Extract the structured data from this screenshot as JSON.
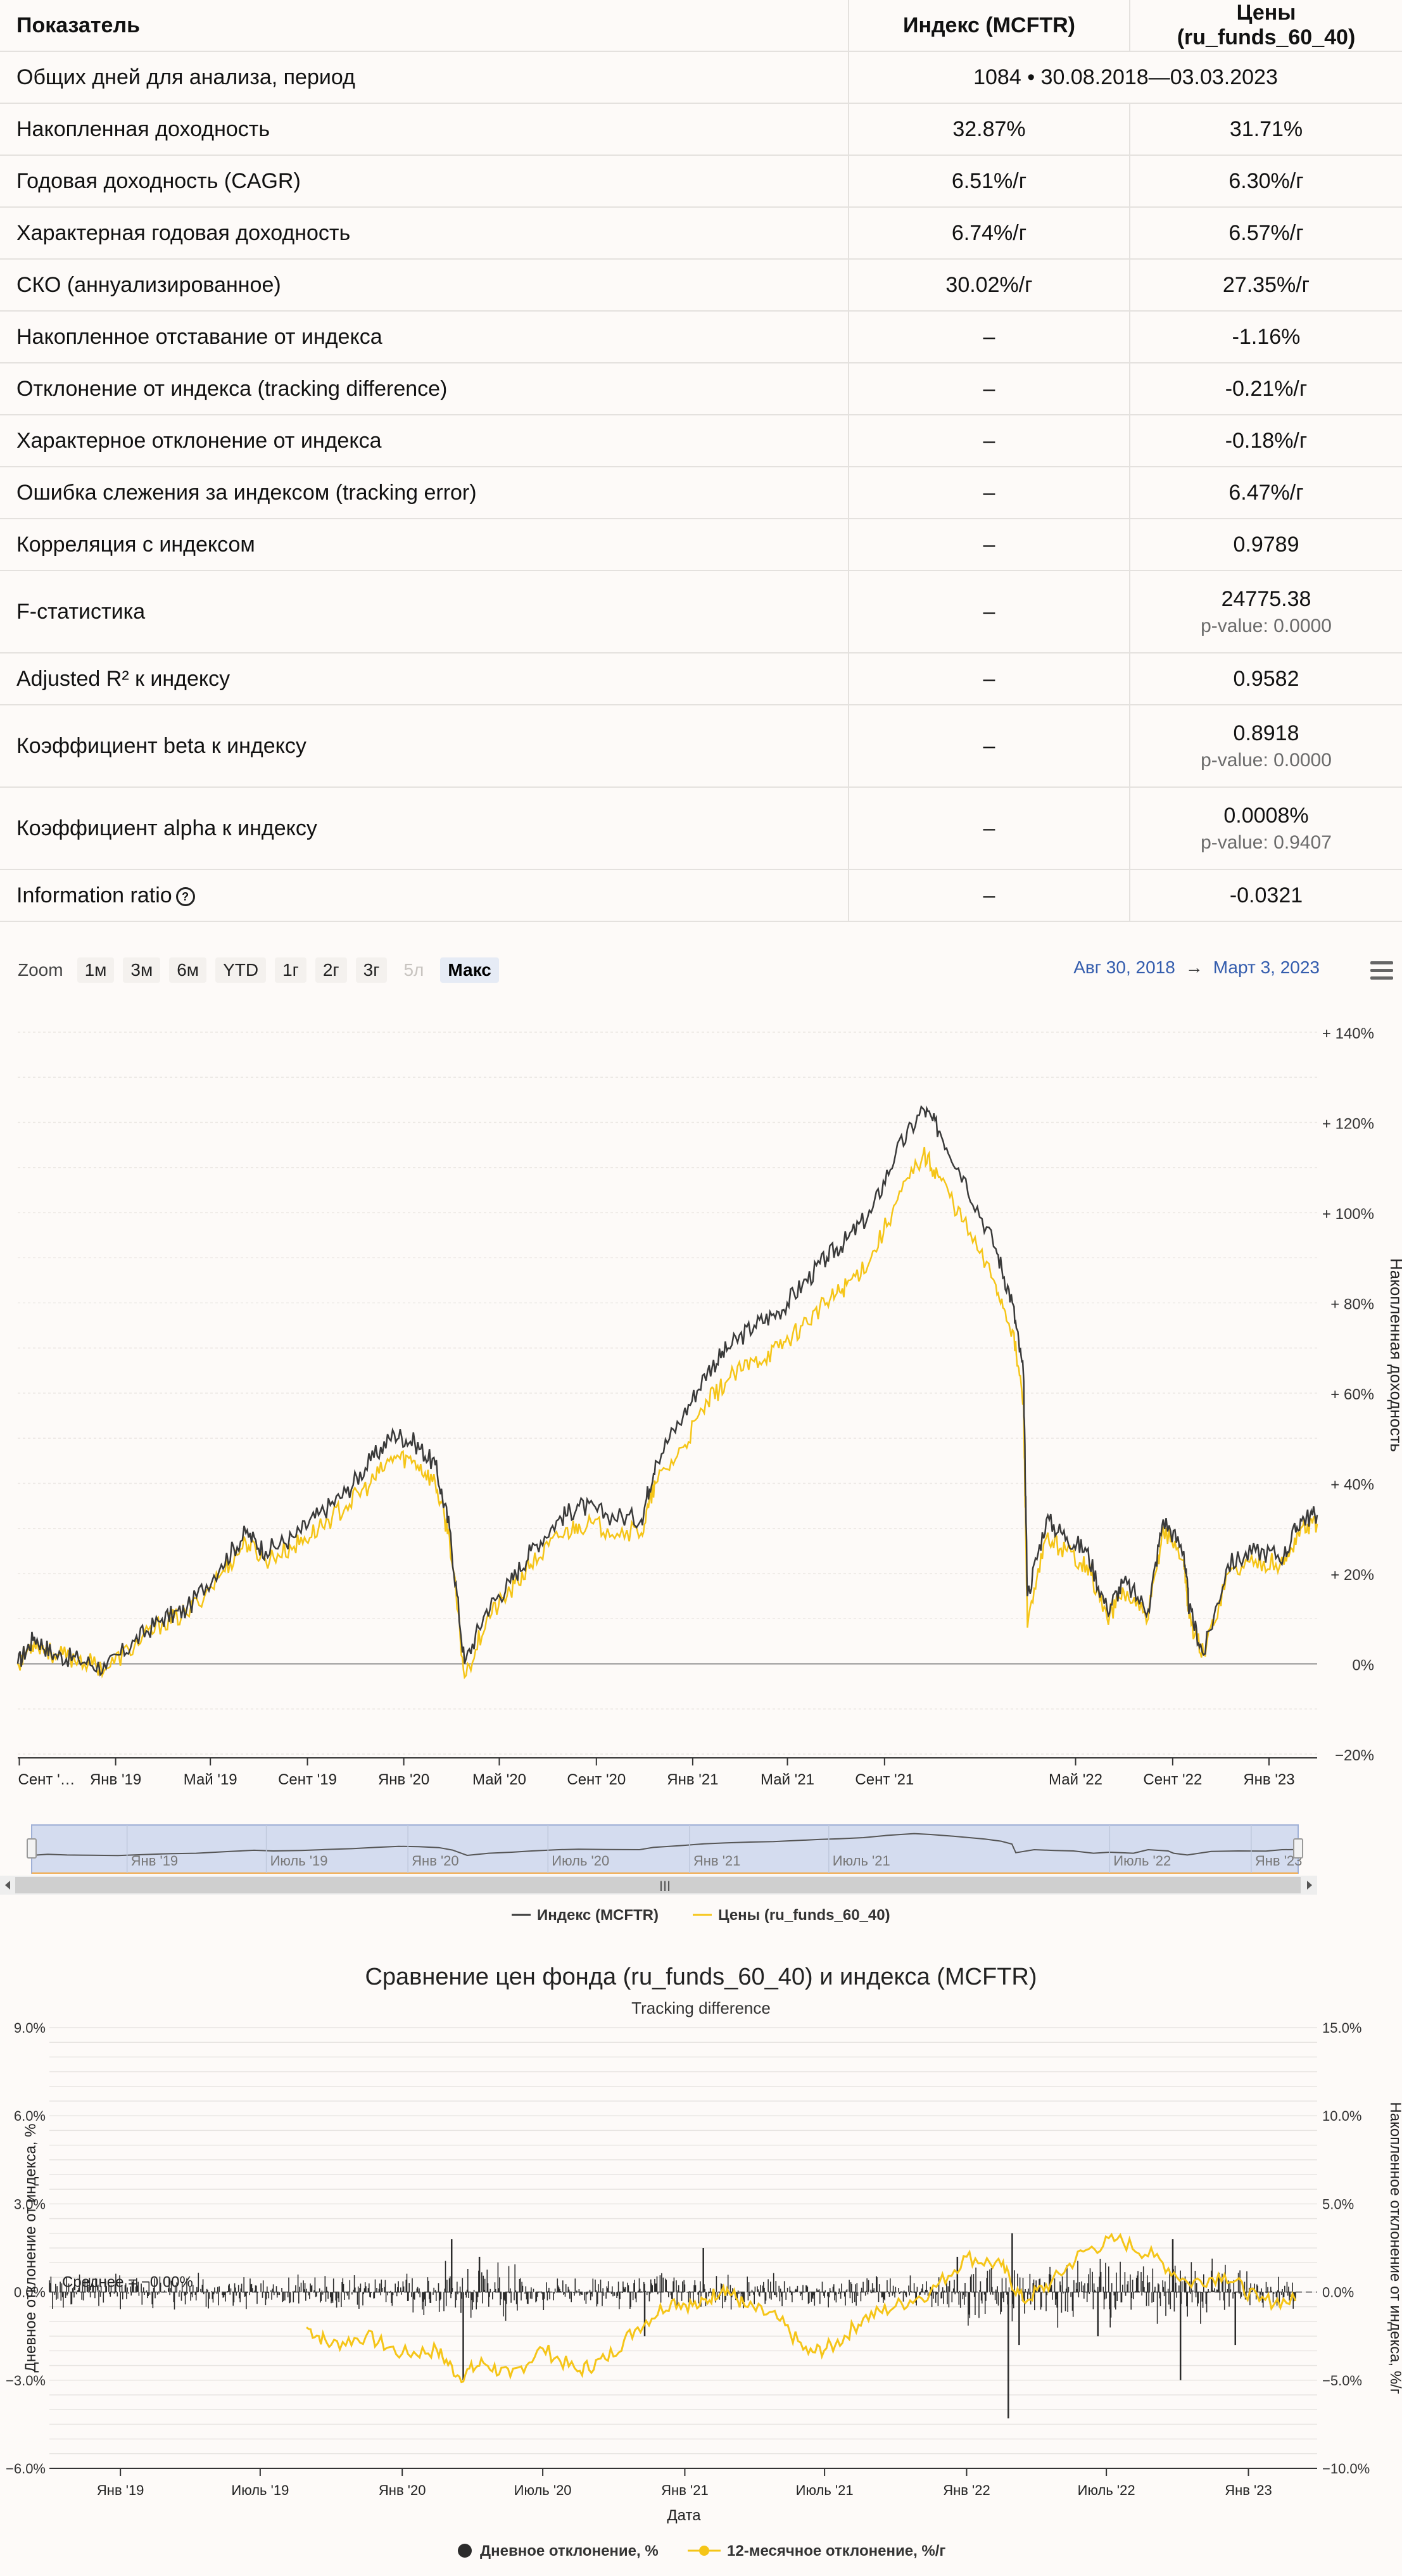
{
  "table": {
    "headers": [
      "Показатель",
      "Индекс (MCFTR)",
      "Цены (ru_funds_60_40)"
    ],
    "period_row": {
      "label": "Общих дней для анализа, период",
      "value": "1084 • 30.08.2018—03.03.2023"
    },
    "rows": [
      {
        "label": "Накопленная доходность",
        "index": "32.87%",
        "fund": "31.71%",
        "fund_sub": ""
      },
      {
        "label": "Годовая доходность (CAGR)",
        "index": "6.51%/г",
        "fund": "6.30%/г",
        "fund_sub": ""
      },
      {
        "label": "Характерная годовая доходность",
        "index": "6.74%/г",
        "fund": "6.57%/г",
        "fund_sub": ""
      },
      {
        "label": "СКО (аннуализированное)",
        "index": "30.02%/г",
        "fund": "27.35%/г",
        "fund_sub": ""
      },
      {
        "label": "Накопленное отставание от индекса",
        "index": "–",
        "fund": "-1.16%",
        "fund_sub": ""
      },
      {
        "label": "Отклонение от индекса (tracking difference)",
        "index": "–",
        "fund": "-0.21%/г",
        "fund_sub": ""
      },
      {
        "label": "Характерное отклонение от индекса",
        "index": "–",
        "fund": "-0.18%/г",
        "fund_sub": ""
      },
      {
        "label": "Ошибка слежения за индексом (tracking error)",
        "index": "–",
        "fund": "6.47%/г",
        "fund_sub": ""
      },
      {
        "label": "Корреляция с индексом",
        "index": "–",
        "fund": "0.9789",
        "fund_sub": ""
      },
      {
        "label": "F-статистика",
        "index": "–",
        "fund": "24775.38",
        "fund_sub": "p-value: 0.0000"
      },
      {
        "label": "Adjusted R² к индексу",
        "index": "–",
        "fund": "0.9582",
        "fund_sub": ""
      },
      {
        "label": "Коэффициент beta к индексу",
        "index": "–",
        "fund": "0.8918",
        "fund_sub": "p-value: 0.0000"
      },
      {
        "label": "Коэффициент alpha к индексу",
        "index": "–",
        "fund": "0.0008%",
        "fund_sub": "p-value: 0.9407"
      },
      {
        "label": "Information ratio",
        "index": "–",
        "fund": "-0.0321",
        "fund_sub": ""
      }
    ],
    "info_icon": "question-circle-icon"
  },
  "toolbar": {
    "zoom_label": "Zoom",
    "zoom_buttons": [
      {
        "label": "1м",
        "state": "normal"
      },
      {
        "label": "3м",
        "state": "normal"
      },
      {
        "label": "6м",
        "state": "normal"
      },
      {
        "label": "YTD",
        "state": "normal"
      },
      {
        "label": "1г",
        "state": "normal"
      },
      {
        "label": "2г",
        "state": "normal"
      },
      {
        "label": "3г",
        "state": "normal"
      },
      {
        "label": "5л",
        "state": "disabled"
      },
      {
        "label": "Макс",
        "state": "active"
      }
    ],
    "range_from": "Авг 30, 2018",
    "range_arrow": "→",
    "range_to": "Март 3, 2023",
    "menu_icon": "hamburger-menu-icon"
  },
  "chart_data": [
    {
      "type": "line",
      "title": "",
      "ylabel": "Накопленная доходность",
      "ylim": [
        -20,
        140
      ],
      "y_ticks": [
        "+ 140%",
        "+ 120%",
        "+ 100%",
        "+ 80%",
        "+ 60%",
        "+ 40%",
        "+ 20%",
        "0%",
        "−20%"
      ],
      "x_ticks": [
        "Сент '…",
        "Янв '19",
        "Май '19",
        "Сент '19",
        "Янв '20",
        "Май '20",
        "Сент '20",
        "Янв '21",
        "Май '21",
        "Сент '21",
        "Май '22",
        "Сент '22",
        "Янв '23"
      ],
      "legend": [
        "Индекс (MCFTR)",
        "Цены (ru_funds_60_40)"
      ],
      "navigator_labels": [
        "Янв '19",
        "Июль '19",
        "Янв '20",
        "Июль '20",
        "Янв '21",
        "Июль '21",
        "Июль '22",
        "Янв '23"
      ],
      "navigator_handle": "III",
      "colors": {
        "index": "#3a3a3a",
        "fund": "#f5c518"
      },
      "x": [
        "2018-08-30",
        "2018-09-20",
        "2018-10-15",
        "2018-11-15",
        "2018-12-20",
        "2019-01-25",
        "2019-03-01",
        "2019-04-01",
        "2019-05-15",
        "2019-06-15",
        "2019-07-10",
        "2019-08-15",
        "2019-09-15",
        "2019-10-20",
        "2019-11-20",
        "2019-12-20",
        "2020-01-15",
        "2020-02-10",
        "2020-02-28",
        "2020-03-18",
        "2020-04-15",
        "2020-05-15",
        "2020-06-10",
        "2020-07-15",
        "2020-08-10",
        "2020-09-15",
        "2020-10-28",
        "2020-11-15",
        "2020-12-20",
        "2021-01-20",
        "2021-02-15",
        "2021-03-20",
        "2021-04-20",
        "2021-05-20",
        "2021-06-20",
        "2021-07-15",
        "2021-08-15",
        "2021-09-15",
        "2021-10-20",
        "2021-11-10",
        "2021-12-10",
        "2022-01-20",
        "2022-02-10",
        "2022-02-24",
        "2022-03-01",
        "2022-03-25",
        "2022-04-20",
        "2022-05-15",
        "2022-06-10",
        "2022-07-01",
        "2022-08-01",
        "2022-08-20",
        "2022-09-15",
        "2022-09-22",
        "2022-10-10",
        "2022-11-10",
        "2022-12-15",
        "2023-01-20",
        "2023-02-10",
        "2023-03-03"
      ],
      "series": [
        {
          "name": "Индекс (MCFTR)",
          "values": [
            0,
            6,
            2,
            1,
            -1,
            5,
            10,
            12,
            22,
            29,
            25,
            28,
            33,
            38,
            45,
            51,
            49,
            44,
            30,
            0,
            12,
            18,
            25,
            32,
            35,
            33,
            32,
            45,
            55,
            65,
            70,
            75,
            78,
            84,
            90,
            94,
            100,
            113,
            123,
            118,
            108,
            92,
            80,
            64,
            15,
            32,
            28,
            25,
            12,
            18,
            12,
            32,
            25,
            12,
            2,
            22,
            25,
            24,
            32,
            33
          ]
        },
        {
          "name": "Цены (ru_funds_60_40)",
          "values": [
            0,
            5,
            2,
            1,
            -1,
            4,
            9,
            11,
            20,
            27,
            23,
            26,
            30,
            35,
            40,
            46,
            45,
            40,
            28,
            -3,
            10,
            16,
            22,
            28,
            31,
            30,
            29,
            40,
            48,
            58,
            63,
            67,
            70,
            75,
            80,
            84,
            90,
            102,
            113,
            108,
            98,
            84,
            74,
            58,
            8,
            28,
            25,
            22,
            10,
            16,
            10,
            30,
            23,
            10,
            2,
            20,
            23,
            22,
            30,
            31
          ]
        }
      ]
    },
    {
      "type": "line",
      "title": "Сравнение цен фонда (ru_funds_60_40) и индекса (MCFTR)",
      "subtitle": "Tracking difference",
      "xlabel": "Дата",
      "ylabel_left": "Дневное отклонение от индекса, %",
      "ylabel_right": "Накопленное отклонение от индекса, %/г",
      "ylim_left": [
        -6,
        9
      ],
      "ylim_right": [
        -10,
        15
      ],
      "y_ticks_left": [
        "9.0%",
        "6.0%",
        "3.0%",
        "0.0%",
        "−3.0%",
        "−6.0%"
      ],
      "y_ticks_right": [
        "15.0%",
        "10.0%",
        "5.0%",
        "0.0%",
        "−5.0%",
        "−10.0%"
      ],
      "x_ticks": [
        "Янв '19",
        "Июль '19",
        "Янв '20",
        "Июль '20",
        "Янв '21",
        "Июль '21",
        "Янв '22",
        "Июль '22",
        "Янв '23"
      ],
      "mean_label": "Среднее = −0.00%",
      "legend": [
        "Дневное отклонение, %",
        "12-месячное отклонение, %/г"
      ],
      "colors": {
        "daily": "#2b2b2b",
        "rolling": "#f5c518"
      },
      "series": [
        {
          "name": "12-месячное отклонение, %/г",
          "x": [
            "2019-08-30",
            "2019-10-01",
            "2019-11-15",
            "2020-01-01",
            "2020-02-15",
            "2020-03-15",
            "2020-04-15",
            "2020-05-20",
            "2020-07-01",
            "2020-08-15",
            "2020-09-20",
            "2020-11-01",
            "2020-12-15",
            "2021-01-20",
            "2021-02-20",
            "2021-03-20",
            "2021-05-01",
            "2021-06-10",
            "2021-07-15",
            "2021-08-20",
            "2021-10-01",
            "2021-11-15",
            "2022-01-01",
            "2022-02-15",
            "2022-03-15",
            "2022-04-20",
            "2022-06-01",
            "2022-07-15",
            "2022-09-01",
            "2022-10-15",
            "2022-12-01",
            "2023-01-15",
            "2023-03-03"
          ],
          "values": [
            -2.0,
            -3.0,
            -2.5,
            -3.5,
            -3.3,
            -4.8,
            -4.0,
            -4.8,
            -3.2,
            -4.5,
            -3.8,
            -2.0,
            -0.5,
            -0.8,
            0.3,
            -0.8,
            -1.5,
            -3.5,
            -3.0,
            -1.5,
            -0.8,
            0.0,
            2.0,
            1.5,
            -0.5,
            0.5,
            2.3,
            3.0,
            2.0,
            0.5,
            1.0,
            -0.5,
            -0.5
          ]
        },
        {
          "name": "Дневное отклонение, %",
          "spikes": [
            {
              "x": "2020-03-05",
              "value": 1.8
            },
            {
              "x": "2020-03-20",
              "value": -3.0
            },
            {
              "x": "2020-04-10",
              "value": 1.2
            },
            {
              "x": "2020-11-10",
              "value": -1.5
            },
            {
              "x": "2021-01-25",
              "value": 1.5
            },
            {
              "x": "2021-12-20",
              "value": 1.2
            },
            {
              "x": "2022-02-24",
              "value": -4.3
            },
            {
              "x": "2022-03-01",
              "value": 2.0
            },
            {
              "x": "2022-03-10",
              "value": -1.8
            },
            {
              "x": "2022-06-20",
              "value": -1.5
            },
            {
              "x": "2022-09-25",
              "value": 1.8
            },
            {
              "x": "2022-10-05",
              "value": -3.0
            },
            {
              "x": "2022-12-15",
              "value": -1.8
            }
          ],
          "typical_amplitude": 0.5
        }
      ]
    }
  ]
}
